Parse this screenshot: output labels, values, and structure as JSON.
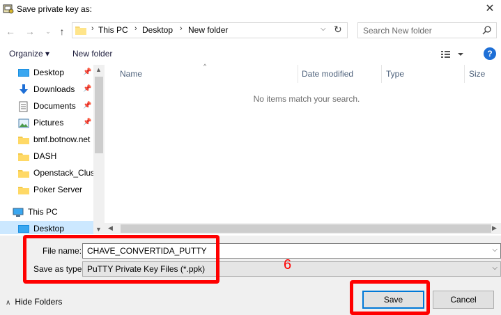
{
  "window": {
    "title": "Save private key as:",
    "app_icon": "putty-keygen-icon"
  },
  "navigation": {
    "breadcrumb": [
      "This PC",
      "Desktop",
      "New folder"
    ],
    "search_placeholder": "Search New folder"
  },
  "toolbar": {
    "organize_label": "Organize ▾",
    "new_folder_label": "New folder",
    "help_label": "?"
  },
  "sidebar": {
    "items": [
      {
        "label": "Desktop",
        "icon": "desktop-icon",
        "pinned": true
      },
      {
        "label": "Downloads",
        "icon": "downloads-icon",
        "pinned": true
      },
      {
        "label": "Documents",
        "icon": "documents-icon",
        "pinned": true
      },
      {
        "label": "Pictures",
        "icon": "pictures-icon",
        "pinned": true
      },
      {
        "label": "bmf.botnow.net",
        "icon": "folder-icon",
        "pinned": false
      },
      {
        "label": "DASH",
        "icon": "folder-icon",
        "pinned": false
      },
      {
        "label": "Openstack_Clust",
        "icon": "folder-icon",
        "pinned": false
      },
      {
        "label": "Poker Server",
        "icon": "folder-icon",
        "pinned": false
      },
      {
        "label": "This PC",
        "icon": "this-pc-icon",
        "pinned": false
      },
      {
        "label": "Desktop",
        "icon": "desktop-icon",
        "pinned": false,
        "selected": true
      }
    ]
  },
  "file_list": {
    "columns": [
      "Name",
      "Date modified",
      "Type",
      "Size"
    ],
    "empty_message": "No items match your search."
  },
  "form": {
    "file_name_label": "File name:",
    "file_name_value": "CHAVE_CONVERTIDA_PUTTY",
    "save_as_type_label": "Save as type:",
    "save_as_type_value": "PuTTY Private Key Files (*.ppk)"
  },
  "footer": {
    "hide_folders_label": "Hide Folders",
    "save_label": "Save",
    "cancel_label": "Cancel"
  },
  "annotation": {
    "step_number": "6",
    "color": "#ff0000"
  },
  "colors": {
    "accent": "#0078d7",
    "selection": "#cce8ff",
    "help": "#1e6fd6"
  }
}
